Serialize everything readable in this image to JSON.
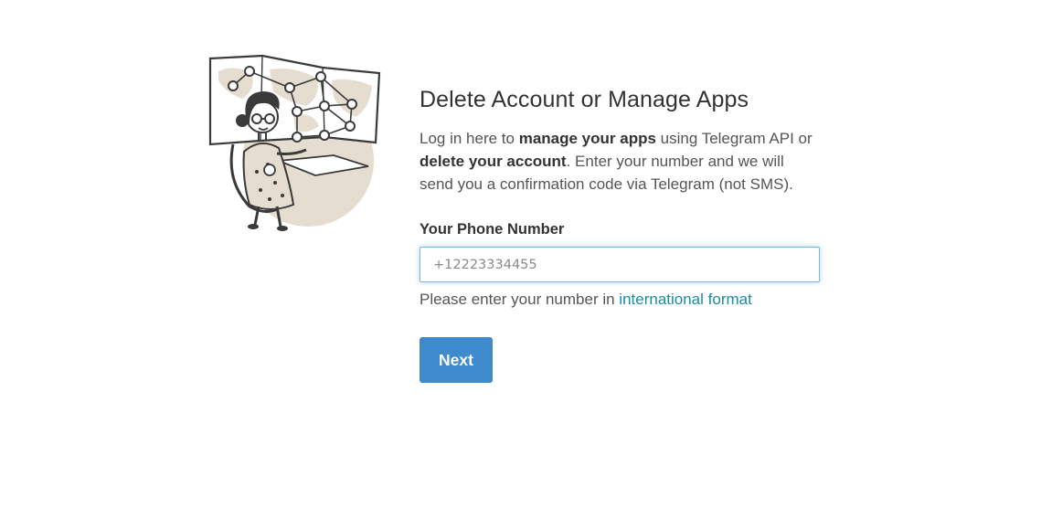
{
  "page": {
    "title": "Delete Account or Manage Apps",
    "description": {
      "part1": "Log in here to ",
      "bold1": "manage your apps",
      "part2": " using Telegram API or ",
      "bold2": "delete your account",
      "part3": ". Enter your number and we will send you a confirmation code via Telegram (not SMS)."
    }
  },
  "form": {
    "phone_label": "Your Phone Number",
    "phone_value": "",
    "phone_placeholder": "+12223334455",
    "hint_text": "Please enter your number in ",
    "hint_link": "international format",
    "next_label": "Next"
  },
  "colors": {
    "accent": "#3e8acd",
    "link": "#1b8aa3",
    "input_focus": "#7fb6d9"
  },
  "icons": {
    "illustration": "telegram-woman-map-illustration"
  }
}
